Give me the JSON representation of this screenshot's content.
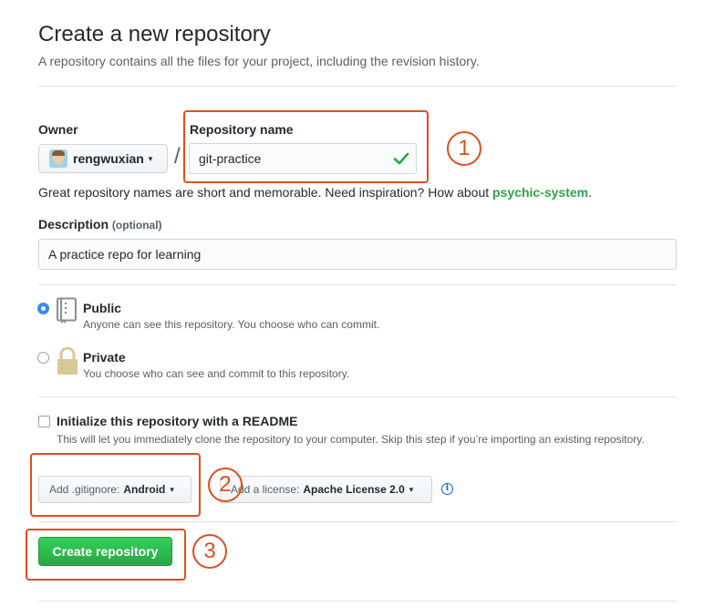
{
  "header": {
    "title": "Create a new repository",
    "subtitle": "A repository contains all the files for your project, including the revision history."
  },
  "owner": {
    "label": "Owner",
    "value": "rengwuxian",
    "caret": "▾"
  },
  "separator": "/",
  "repo_name": {
    "label": "Repository name",
    "value": "git-practice",
    "valid_color": "#28a745"
  },
  "hint": {
    "text": "Great repository names are short and memorable. Need inspiration? How about ",
    "suggestion": "psychic-system",
    "end": "."
  },
  "description": {
    "label": "Description",
    "optional": "(optional)",
    "value": "A practice repo for learning"
  },
  "visibility": {
    "selected": "public",
    "public": {
      "title": "Public",
      "note": "Anyone can see this repository. You choose who can commit.",
      "icon": "repo-book-icon"
    },
    "private": {
      "title": "Private",
      "note": "You choose who can see and commit to this repository.",
      "icon": "lock-icon"
    }
  },
  "readme": {
    "checked": false,
    "label": "Initialize this repository with a README",
    "note": "This will let you immediately clone the repository to your computer. Skip this step if you’re importing an existing repository."
  },
  "gitignore": {
    "prefix": "Add .gitignore:",
    "value": "Android",
    "caret": "▾"
  },
  "license": {
    "prefix": "Add a license:",
    "value": "Apache License 2.0",
    "caret": "▾",
    "info_icon": "i"
  },
  "submit": {
    "label": "Create repository",
    "color": "#28a745"
  },
  "annotations": {
    "color": "#e04e1e",
    "step1": "1",
    "step2": "2",
    "step3": "3"
  }
}
